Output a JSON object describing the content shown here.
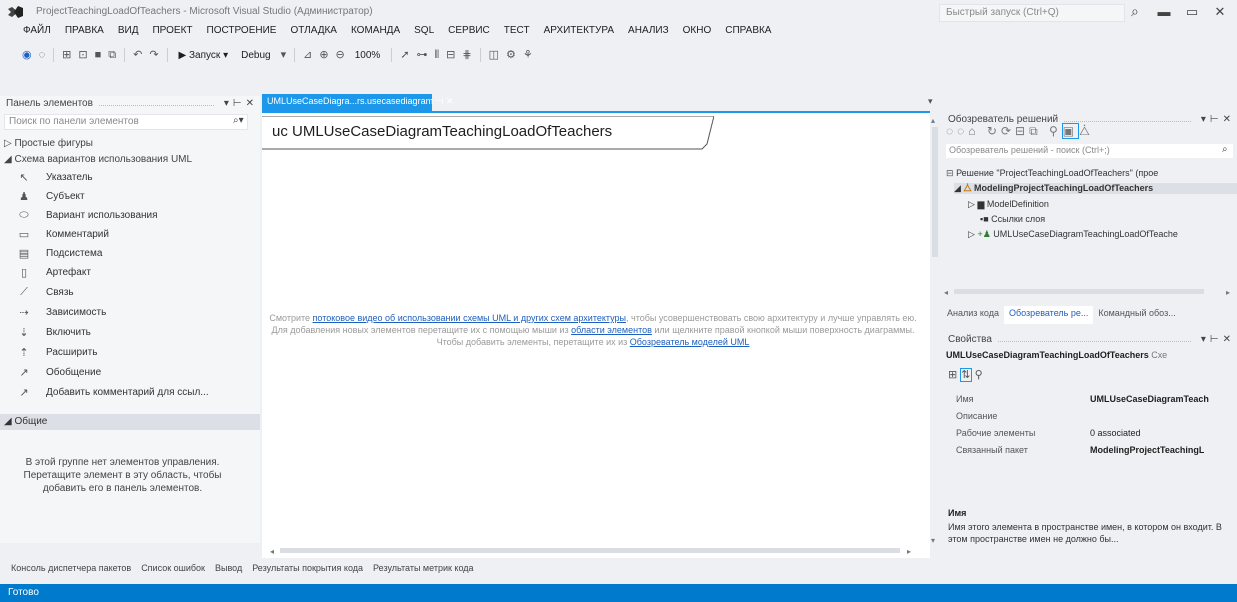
{
  "window": {
    "title": "ProjectTeachingLoadOfTeachers - Microsoft Visual Studio (Администратор)",
    "quick_launch_placeholder": "Быстрый запуск (Ctrl+Q)"
  },
  "menu": [
    "ФАЙЛ",
    "ПРАВКА",
    "ВИД",
    "ПРОЕКТ",
    "ПОСТРОЕНИЕ",
    "ОТЛАДКА",
    "КОМАНДА",
    "SQL",
    "СЕРВИС",
    "ТЕСТ",
    "АРХИТЕКТУРА",
    "АНАЛИЗ",
    "ОКНО",
    "СПРАВКА"
  ],
  "toolbar": {
    "start_label": "▶ Запуск ▾",
    "config_label": "Debug",
    "zoom_label": "100%"
  },
  "toolbox": {
    "title": "Панель элементов",
    "search_placeholder": "Поиск по панели элементов",
    "group_simple": "▷ Простые фигуры",
    "group_uml": "◢ Схема вариантов использования UML",
    "items": [
      {
        "label": "Указатель",
        "icon": "pointer-icon",
        "glyph": "↖"
      },
      {
        "label": "Субъект",
        "icon": "actor-icon",
        "glyph": "♟"
      },
      {
        "label": "Вариант использования",
        "icon": "usecase-icon",
        "glyph": "⬭"
      },
      {
        "label": "Комментарий",
        "icon": "comment-icon",
        "glyph": "▭"
      },
      {
        "label": "Подсистема",
        "icon": "subsystem-icon",
        "glyph": "▤"
      },
      {
        "label": "Артефакт",
        "icon": "artifact-icon",
        "glyph": "▯"
      },
      {
        "label": "Связь",
        "icon": "association-icon",
        "glyph": "⟋"
      },
      {
        "label": "Зависимость",
        "icon": "dependency-icon",
        "glyph": "⇢"
      },
      {
        "label": "Включить",
        "icon": "include-icon",
        "glyph": "⇣"
      },
      {
        "label": "Расширить",
        "icon": "extend-icon",
        "glyph": "⇡"
      },
      {
        "label": "Обобщение",
        "icon": "generalization-icon",
        "glyph": "↗"
      },
      {
        "label": "Добавить комментарий для ссыл...",
        "icon": "comment-link-icon",
        "glyph": "↗"
      }
    ],
    "general_group": "◢ Общие",
    "empty_text": "В этой группе нет элементов управления. Перетащите элемент в эту область, чтобы добавить его в панель элементов."
  },
  "document": {
    "tab_label": "UMLUseCaseDiagra...rs.usecasediagram",
    "diagram_title": "uc UMLUseCaseDiagramTeachingLoadOfTeachers",
    "hint_prefix": "Смотрите ",
    "hint_link1": "потоковое видео об использовании схемы UML и других схем архитектуры",
    "hint_middle1": ", чтобы усовершенствовать свою архитектуру и лучше управлять ею.",
    "hint_line2_prefix": "Для добавления новых элементов перетащите их с помощью мыши из ",
    "hint_link2": "области элементов",
    "hint_line2_suffix": " или щелкните правой кнопкой мыши поверхность диаграммы. Чтобы добавить элементы, перетащите их из ",
    "hint_link3": "Обозреватель моделей UML"
  },
  "solution_explorer": {
    "title": "Обозреватель решений",
    "search_placeholder": "Обозреватель решений - поиск (Ctrl+;)",
    "tree": [
      {
        "label": "Решение \"ProjectTeachingLoadOfTeachers\" (прое",
        "bold": false
      },
      {
        "label": "ModelingProjectTeachingLoadOfTeachers",
        "bold": true
      },
      {
        "label": "ModelDefinition",
        "bold": false
      },
      {
        "label": "Ссылки слоя",
        "bold": false
      },
      {
        "label": "UMLUseCaseDiagramTeachingLoadOfTeache",
        "bold": false
      }
    ],
    "tabs": [
      "Анализ кода",
      "Обозреватель ре...",
      "Командный обоз..."
    ]
  },
  "properties": {
    "title": "Свойства",
    "object_name": "UMLUseCaseDiagramTeachingLoadOfTeachers",
    "object_type": "Схе",
    "rows": [
      {
        "name": "Имя",
        "value": "UMLUseCaseDiagramTeach"
      },
      {
        "name": "Описание",
        "value": ""
      },
      {
        "name": "Рабочие элементы",
        "value": "0 associated"
      },
      {
        "name": "Связанный пакет",
        "value": "ModelingProjectTeachingL"
      }
    ],
    "help_title": "Имя",
    "help_text": "Имя этого элемента в пространстве имен, в котором он входит. В этом пространстве имен не должно бы..."
  },
  "bottom_tabs": [
    "Консоль диспетчера пакетов",
    "Список ошибок",
    "Вывод",
    "Результаты покрытия кода",
    "Результаты метрик кода"
  ],
  "status": "Готово"
}
